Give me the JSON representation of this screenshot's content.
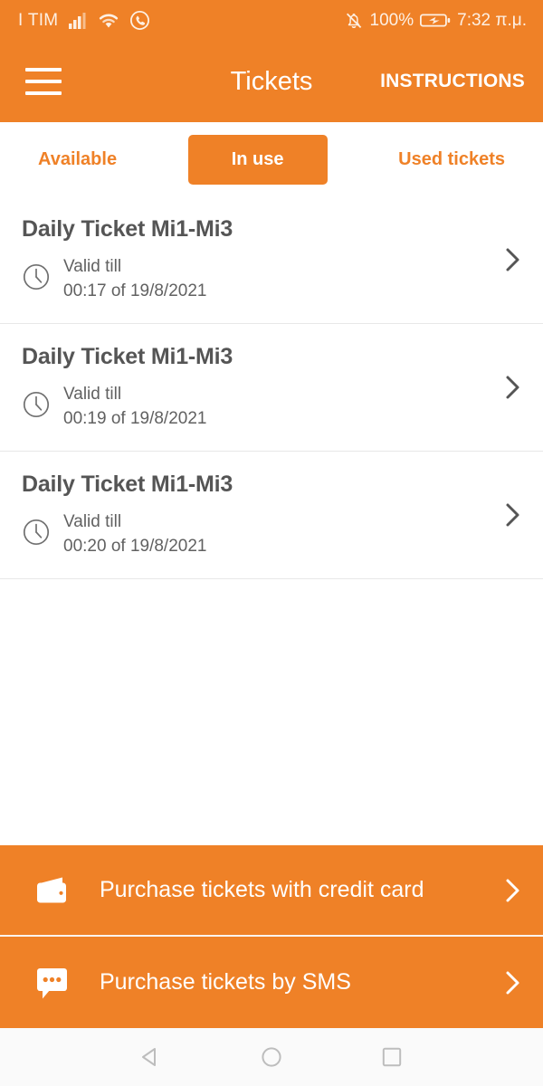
{
  "status_bar": {
    "carrier": "I TIM",
    "signal_icon": "signal-bars-icon",
    "wifi_icon": "wifi-icon",
    "viber_icon": "viber-icon",
    "mute_icon": "bell-muted-icon",
    "battery_percent": "100%",
    "battery_icon": "battery-charging-icon",
    "time": "7:32 π.μ."
  },
  "app_bar": {
    "menu_icon": "hamburger-menu-icon",
    "title": "Tickets",
    "action_label": "INSTRUCTIONS"
  },
  "tabs": [
    {
      "label": "Available",
      "selected": false
    },
    {
      "label": "In use",
      "selected": true
    },
    {
      "label": "Used tickets",
      "selected": false
    }
  ],
  "tickets": [
    {
      "title": "Daily Ticket Mi1-Mi3",
      "valid_label": "Valid till",
      "valid_value": "00:17 of 19/8/2021",
      "clock_icon": "clock-icon",
      "chevron_icon": "chevron-right-icon"
    },
    {
      "title": "Daily Ticket Mi1-Mi3",
      "valid_label": "Valid till",
      "valid_value": "00:19 of 19/8/2021",
      "clock_icon": "clock-icon",
      "chevron_icon": "chevron-right-icon"
    },
    {
      "title": "Daily Ticket Mi1-Mi3",
      "valid_label": "Valid till",
      "valid_value": "00:20 of 19/8/2021",
      "clock_icon": "clock-icon",
      "chevron_icon": "chevron-right-icon"
    }
  ],
  "actions": [
    {
      "label": "Purchase tickets with credit card",
      "icon": "wallet-icon",
      "chevron_icon": "chevron-right-icon"
    },
    {
      "label": "Purchase tickets by SMS",
      "icon": "sms-bubble-icon",
      "chevron_icon": "chevron-right-icon"
    }
  ],
  "nav_bar": {
    "back_icon": "back-triangle-icon",
    "home_icon": "home-circle-icon",
    "recents_icon": "recents-square-icon"
  },
  "colors": {
    "accent": "#EF8127",
    "title_text": "#555555",
    "body_text": "#616161",
    "divider": "#E8E8E8",
    "nav_icon": "#BDBDBD"
  }
}
